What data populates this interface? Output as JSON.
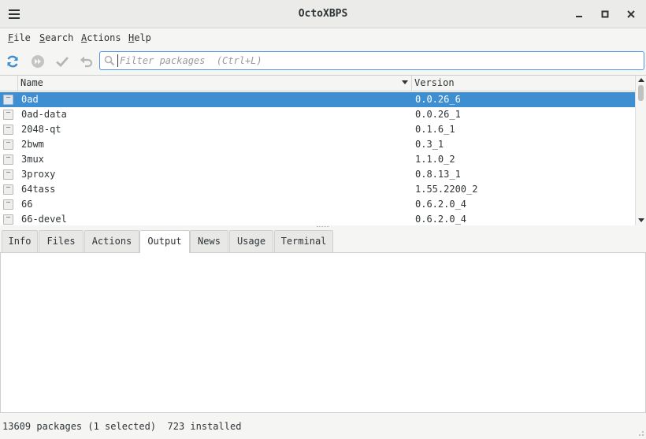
{
  "window": {
    "title": "OctoXBPS"
  },
  "menubar": {
    "items": [
      "File",
      "Search",
      "Actions",
      "Help"
    ]
  },
  "toolbar": {
    "search_placeholder": "Filter packages  (Ctrl+L)"
  },
  "table": {
    "columns": [
      "Name",
      "Version"
    ],
    "rows": [
      {
        "name": "0ad",
        "version": "0.0.26_6",
        "selected": true
      },
      {
        "name": "0ad-data",
        "version": "0.0.26_1"
      },
      {
        "name": "2048-qt",
        "version": "0.1.6_1"
      },
      {
        "name": "2bwm",
        "version": "0.3_1"
      },
      {
        "name": "3mux",
        "version": "1.1.0_2"
      },
      {
        "name": "3proxy",
        "version": "0.8.13_1"
      },
      {
        "name": "64tass",
        "version": "1.55.2200_2"
      },
      {
        "name": "66",
        "version": "0.6.2.0_4"
      },
      {
        "name": "66-devel",
        "version": "0.6.2.0_4"
      }
    ]
  },
  "tabs": {
    "items": [
      "Info",
      "Files",
      "Actions",
      "Output",
      "News",
      "Usage",
      "Terminal"
    ],
    "active": "Output"
  },
  "statusbar": {
    "text": "13609 packages (1 selected)  723 installed"
  },
  "colors": {
    "selection": "#3d8fd1",
    "sync_icon": "#3d8fd1",
    "focus_border": "#5294e2"
  }
}
